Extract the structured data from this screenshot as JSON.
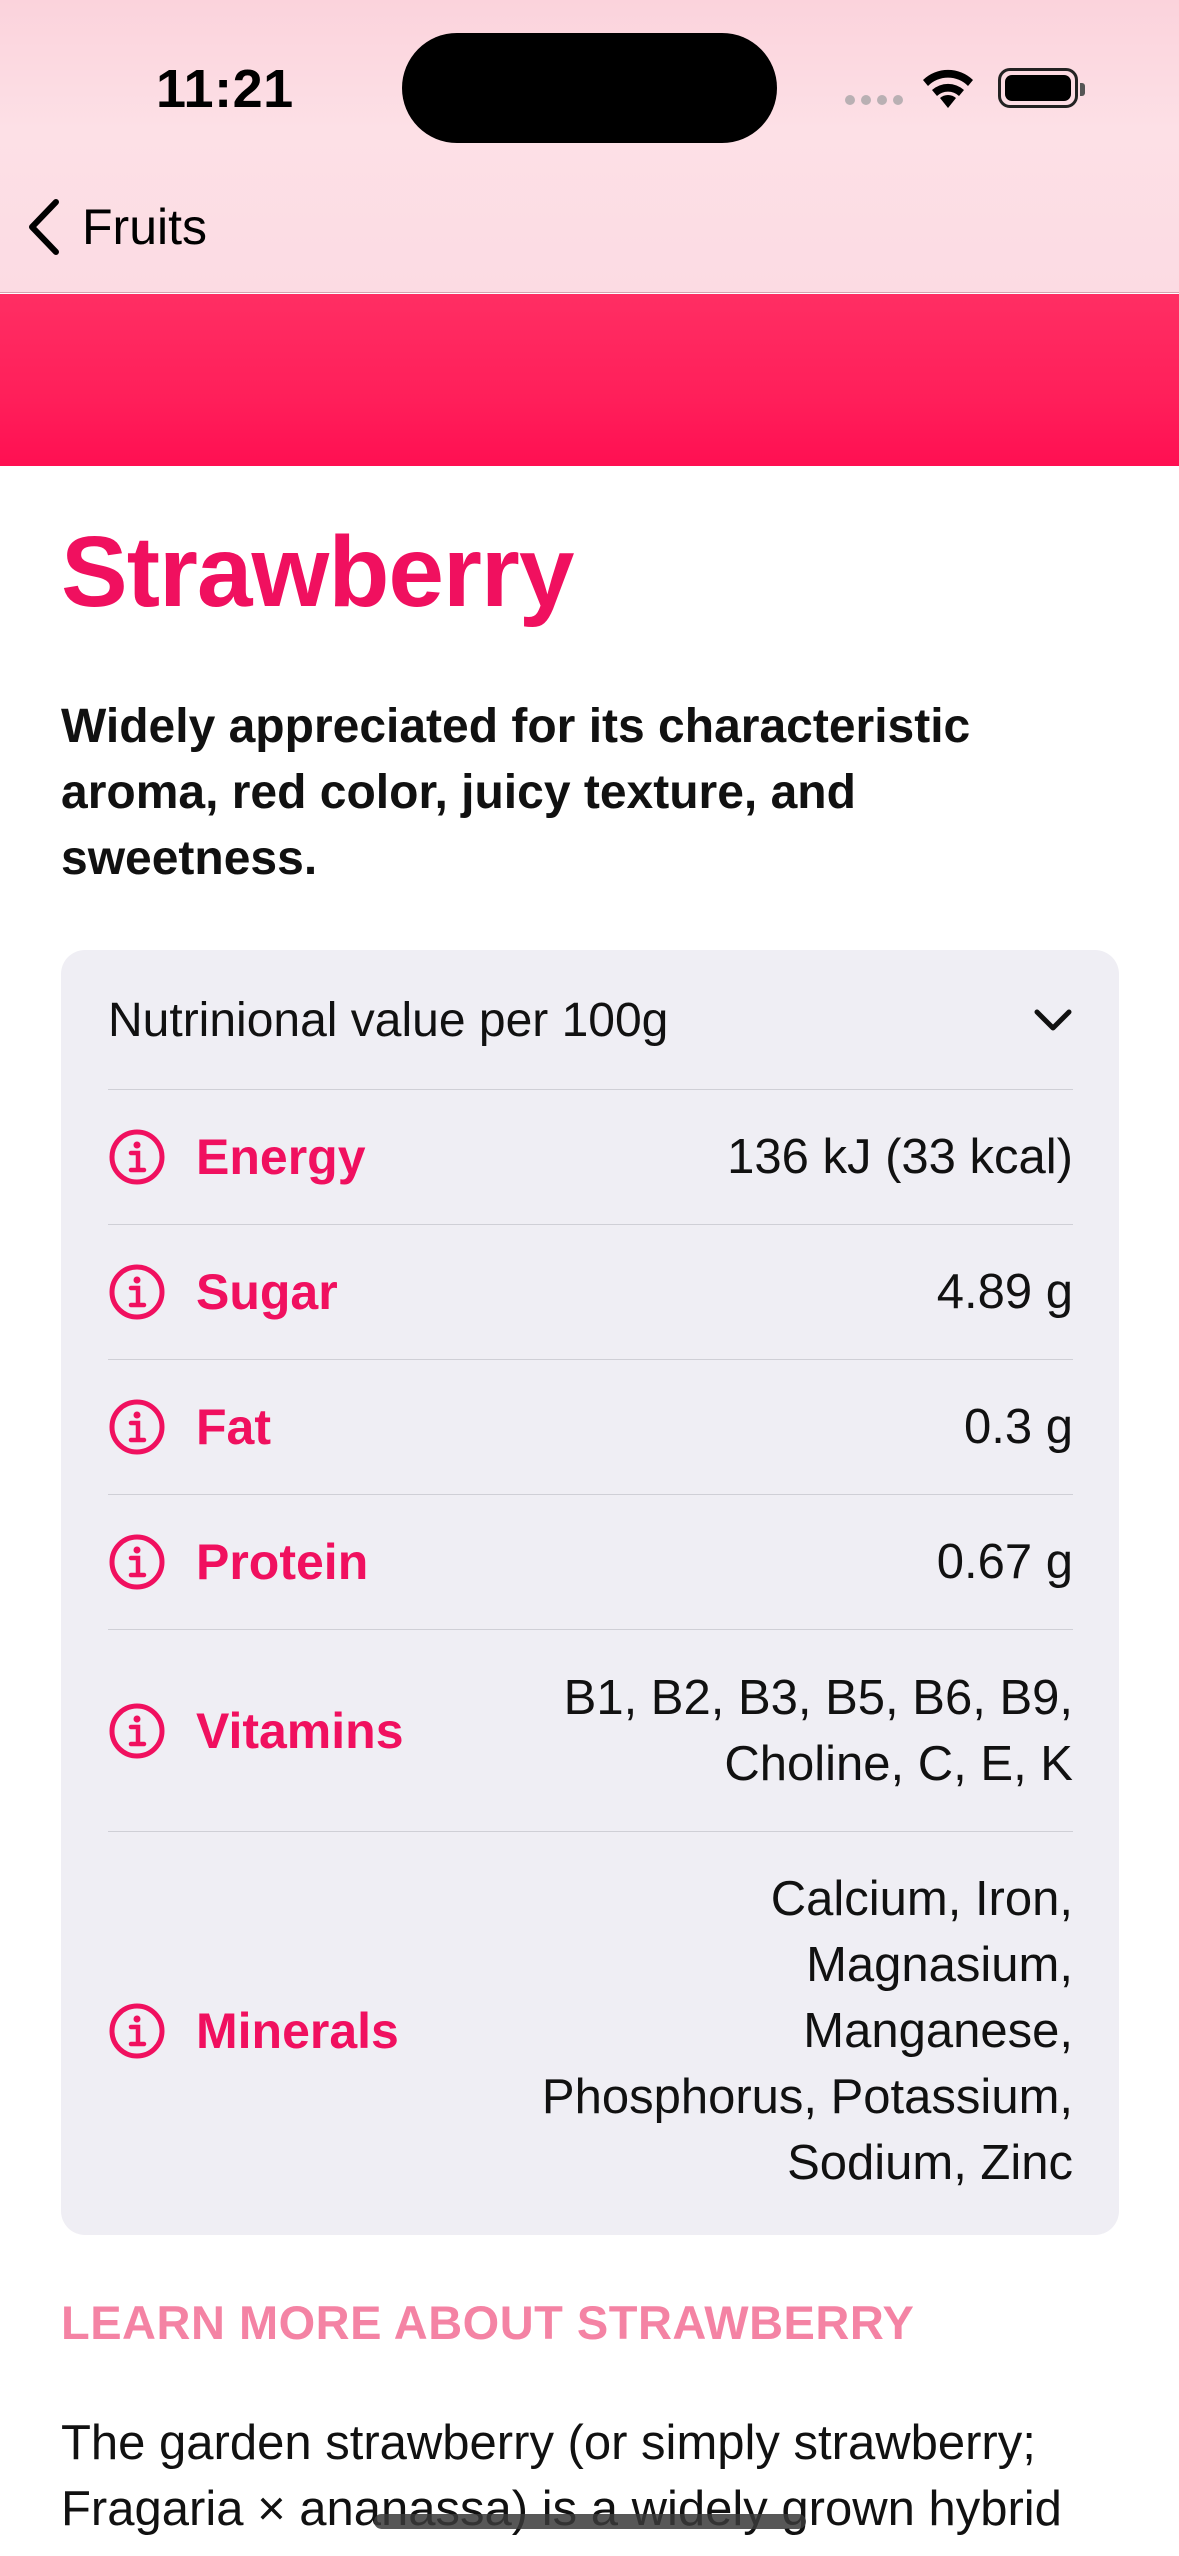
{
  "status_bar": {
    "time": "11:21",
    "icons": [
      "cellular-signal-icon",
      "wifi-icon",
      "battery-icon"
    ]
  },
  "nav": {
    "back_label": "Fruits",
    "back_icon": "chevron-left-icon"
  },
  "colors": {
    "accent": "#f0105f",
    "hero": "#ff1f5a",
    "header_bg": "#fcdbe3",
    "card_bg": "#efeef4",
    "section_header": "#f483a4"
  },
  "fruit": {
    "title": "Strawberry",
    "headline": "Widely appreciated for its characteristic aroma,  red color, juicy texture, and sweetness."
  },
  "nutrition": {
    "header": "Nutrinional value per 100g",
    "expanded": true,
    "rows": [
      {
        "label": "Energy",
        "value": "136 kJ (33 kcal)",
        "icon": "info-circle-icon"
      },
      {
        "label": "Sugar",
        "value": "4.89 g",
        "icon": "info-circle-icon"
      },
      {
        "label": "Fat",
        "value": "0.3 g",
        "icon": "info-circle-icon"
      },
      {
        "label": "Protein",
        "value": "0.67 g",
        "icon": "info-circle-icon"
      },
      {
        "label": "Vitamins",
        "value_lines": [
          "B1, B2, B3, B5, B6, B9,",
          "Choline, C, E, K"
        ],
        "icon": "info-circle-icon"
      },
      {
        "label": "Minerals",
        "value_lines": [
          "Calcium, Iron,",
          "Magnasium,",
          "Manganese,",
          "Phosphorus, Potassium,",
          "Sodium, Zinc"
        ],
        "icon": "info-circle-icon"
      }
    ]
  },
  "learn_more": {
    "header": "LEARN MORE ABOUT STRAWBERRY",
    "lines": [
      "The garden strawberry (or simply strawberry;",
      "Fragaria × ananassa) is a widely grown hybrid"
    ]
  }
}
